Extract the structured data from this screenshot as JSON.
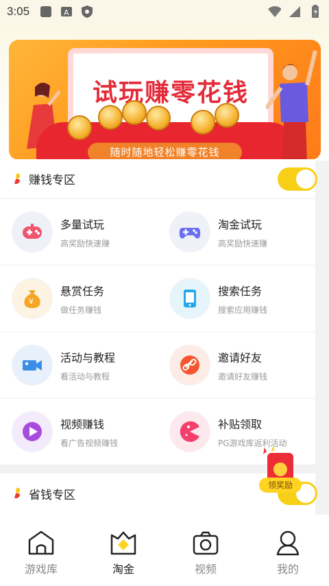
{
  "status_bar": {
    "time": "3:05",
    "left_icons": [
      "square-icon",
      "a-box-icon",
      "shield-icon"
    ],
    "right_icons": [
      "wifi-icon",
      "signal-icon",
      "battery-icon"
    ]
  },
  "banner": {
    "headline": "试玩赚零花钱",
    "ribbon": "随时随地轻松赚零花钱"
  },
  "earn_section": {
    "title": "赚钱专区",
    "toggle_on": true,
    "items": [
      {
        "title": "多量试玩",
        "subtitle": "高奖励快速赚",
        "icon": "gamepad-icon",
        "color": "#f2536e"
      },
      {
        "title": "淘金试玩",
        "subtitle": "高奖励快速赚",
        "icon": "controller-icon",
        "color": "#6b70f0"
      },
      {
        "title": "悬赏任务",
        "subtitle": "做任务赚钱",
        "icon": "money-bag-icon",
        "color": "#f5a623"
      },
      {
        "title": "搜索任务",
        "subtitle": "搜索应用赚钱",
        "icon": "tablet-icon",
        "color": "#24a8e8"
      },
      {
        "title": "活动与教程",
        "subtitle": "看活动与教程",
        "icon": "video-camera-icon",
        "color": "#3b8ee8"
      },
      {
        "title": "邀请好友",
        "subtitle": "邀请好友赚钱",
        "icon": "link-icon",
        "color": "#f5552e"
      },
      {
        "title": "视频赚钱",
        "subtitle": "看广告视频赚钱",
        "icon": "play-icon",
        "color": "#a84ce0"
      },
      {
        "title": "补贴领取",
        "subtitle": "PG游戏库返利活动",
        "icon": "pacman-icon",
        "color": "#f43f6b"
      }
    ]
  },
  "save_section": {
    "title": "省钱专区",
    "toggle_on": true
  },
  "floating_reward": {
    "label": "领奖励"
  },
  "bottom_nav": [
    {
      "label": "游戏库",
      "icon": "house-icon",
      "active": false
    },
    {
      "label": "淘金",
      "icon": "gold-diamond-icon",
      "active": true
    },
    {
      "label": "视频",
      "icon": "camera-icon",
      "active": false
    },
    {
      "label": "我的",
      "icon": "person-icon",
      "active": false
    }
  ]
}
